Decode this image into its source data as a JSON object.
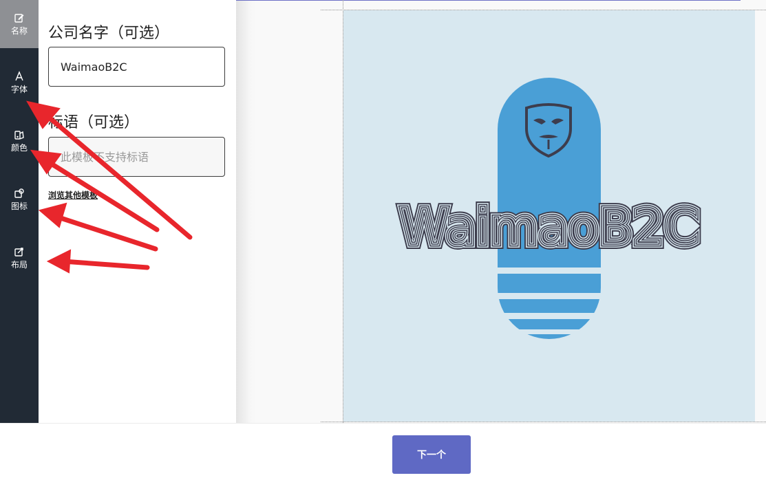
{
  "sidebar": {
    "items": [
      {
        "label": "名称",
        "icon": "edit-icon",
        "active": true
      },
      {
        "label": "字体",
        "icon": "font-icon",
        "active": false
      },
      {
        "label": "颜色",
        "icon": "palette-icon",
        "active": false
      },
      {
        "label": "图标",
        "icon": "shapes-icon",
        "active": false
      },
      {
        "label": "布局",
        "icon": "layout-icon",
        "active": false
      }
    ]
  },
  "panel": {
    "company_label": "公司名字（可选）",
    "company_value": "WaimaoB2C",
    "slogan_label": "标语（可选）",
    "slogan_placeholder": "此模板不支持标语",
    "browse_link": "浏览其他模板"
  },
  "preview": {
    "logo_text": "WaimaoB2C",
    "canvas_color": "#d8e8f0",
    "shape_color": "#4a9fd6",
    "text_color": "#3d3d4d",
    "mask_icon": "mask-icon"
  },
  "footer": {
    "next_label": "下一个"
  },
  "colors": {
    "sidebar_bg": "#212a35",
    "accent": "#5f69c4",
    "annotation_arrow": "#e8262c"
  }
}
